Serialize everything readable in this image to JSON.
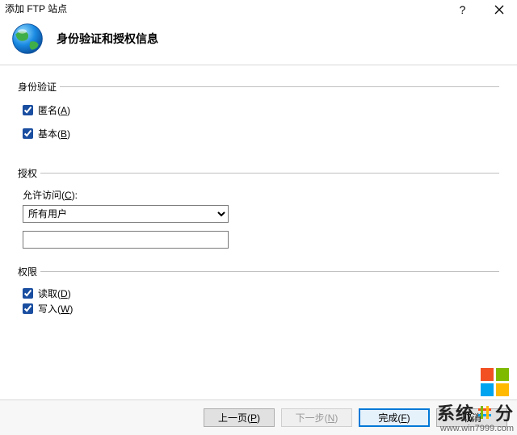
{
  "window": {
    "title": "添加 FTP 站点"
  },
  "header": {
    "page_title": "身份验证和授权信息"
  },
  "auth_section": {
    "legend": "身份验证",
    "anonymous": {
      "label": "匿名",
      "accel": "A",
      "checked": true
    },
    "basic": {
      "label": "基本",
      "accel": "B",
      "checked": true
    }
  },
  "authorization_section": {
    "legend": "授权",
    "allow_access": {
      "label": "允许访问",
      "accel": "C"
    },
    "selected_option": "所有用户",
    "specific_value": ""
  },
  "permissions_section": {
    "legend": "权限",
    "read": {
      "label": "读取",
      "accel": "D",
      "checked": true
    },
    "write": {
      "label": "写入",
      "accel": "W",
      "checked": true
    }
  },
  "footer": {
    "prev": {
      "label": "上一页",
      "accel": "P"
    },
    "next": {
      "label": "下一步",
      "accel": "N"
    },
    "finish": {
      "label": "完成",
      "accel": "F"
    },
    "cancel": {
      "label": "取消"
    }
  },
  "watermark": {
    "line1_a": "系统",
    "line1_b": "分",
    "line2": "www.win7999.com"
  }
}
